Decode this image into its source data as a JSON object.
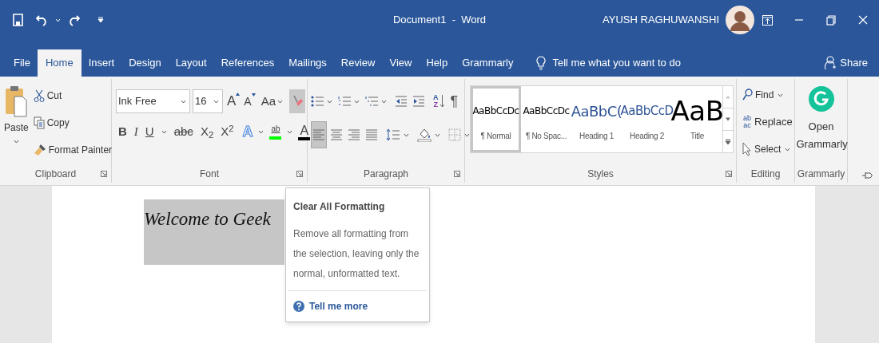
{
  "title_bar": {
    "title": "Document1  -  Word",
    "user": "AYUSH RAGHUWANSHI"
  },
  "tabs": [
    {
      "label": "File",
      "selected": false
    },
    {
      "label": "Home",
      "selected": true
    },
    {
      "label": "Insert",
      "selected": false
    },
    {
      "label": "Design",
      "selected": false
    },
    {
      "label": "Layout",
      "selected": false
    },
    {
      "label": "References",
      "selected": false
    },
    {
      "label": "Mailings",
      "selected": false
    },
    {
      "label": "Review",
      "selected": false
    },
    {
      "label": "View",
      "selected": false
    },
    {
      "label": "Help",
      "selected": false
    },
    {
      "label": "Grammarly",
      "selected": false
    }
  ],
  "tell_me": "Tell me what you want to do",
  "share": "Share",
  "clipboard": {
    "paste": "Paste",
    "cut": "Cut",
    "copy": "Copy",
    "format_painter": "Format Painter",
    "label": "Clipboard"
  },
  "font": {
    "name": "Ink Free",
    "size": "16",
    "grow": "A",
    "shrink": "A",
    "change_case": "Aa",
    "clear_formatting_hovered": true,
    "styles": [
      {
        "kind": "bold",
        "label": "B"
      },
      {
        "kind": "italic",
        "label": "I"
      },
      {
        "kind": "underline",
        "label": "U"
      },
      {
        "kind": "strike",
        "label": "abc"
      },
      {
        "kind": "sub",
        "label": "X$_{2}$"
      },
      {
        "kind": "sup",
        "label": "X$^{2}$"
      }
    ],
    "text_effects": "A",
    "highlight": {
      "label": "ab",
      "color": "#00ff00"
    },
    "font_color": {
      "label": "A",
      "color": "#000000"
    },
    "label": "Font"
  },
  "paragraph": {
    "alignments": [
      {
        "selected": true
      },
      {
        "selected": false
      },
      {
        "selected": false
      },
      {
        "selected": false
      }
    ],
    "sort": [
      "A",
      "Z"
    ],
    "pilcrow": "¶",
    "label": "Paragraph"
  },
  "styles": {
    "items": [
      {
        "kind": "normal",
        "preview": "AaBbCcDc",
        "name": "¶ Normal",
        "selected": true
      },
      {
        "kind": "no_spacing",
        "preview": "AaBbCcDc",
        "name": "¶ No Spac...",
        "selected": false
      },
      {
        "kind": "heading1",
        "preview": "AaBbC(",
        "name": "Heading 1",
        "selected": false
      },
      {
        "kind": "heading2",
        "preview": "AaBbCcD",
        "name": "Heading 2",
        "selected": false
      },
      {
        "kind": "title",
        "preview": "AaB",
        "name": "Title",
        "selected": false
      }
    ],
    "label": "Styles"
  },
  "editing": {
    "find": "Find",
    "replace_icon": [
      "ab",
      "ac"
    ],
    "replace": "Replace",
    "select": "Select",
    "label": "Editing"
  },
  "grammarly": {
    "open": "Open Grammarly",
    "label": "Grammarly"
  },
  "document": {
    "text": "Welcome to Geek"
  },
  "tooltip": {
    "title": "Clear All Formatting",
    "body": "Remove all formatting from the selection, leaving only the normal, unformatted text.",
    "link": "Tell me more"
  }
}
